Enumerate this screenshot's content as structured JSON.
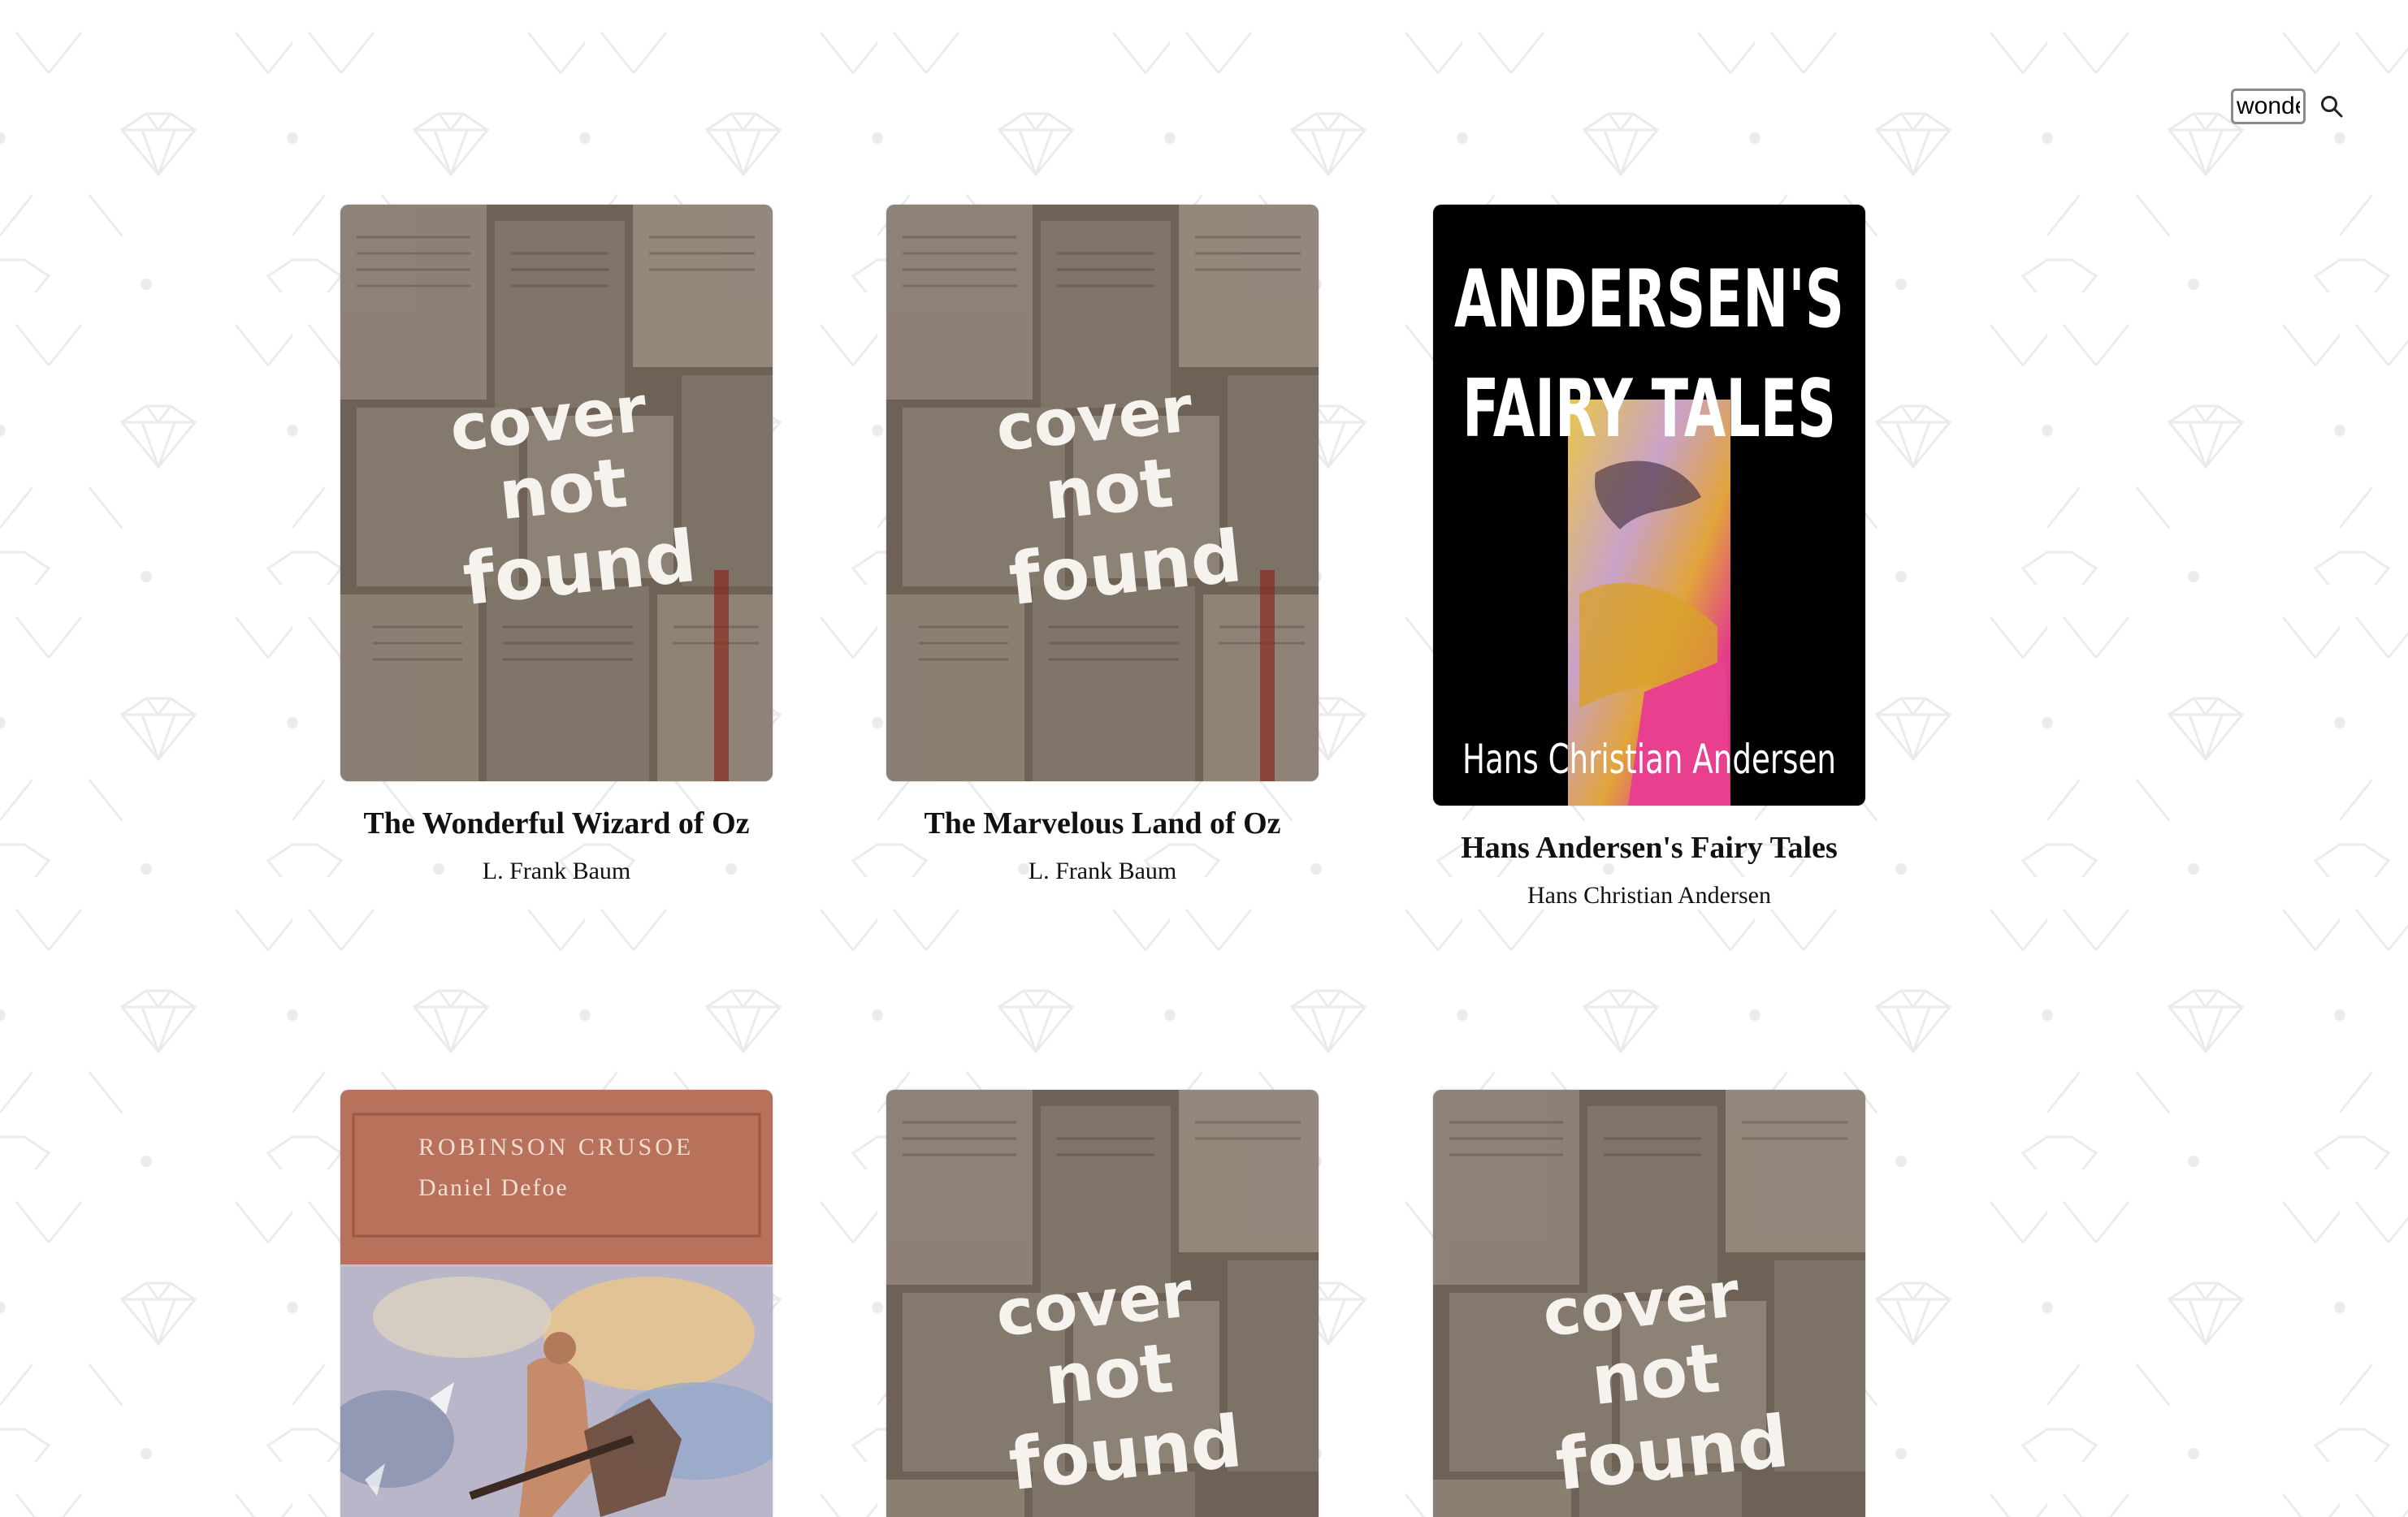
{
  "search": {
    "value": "wonde",
    "icon": "search-icon"
  },
  "books": [
    {
      "title": "The Wonderful Wizard of Oz",
      "author": "L. Frank Baum",
      "cover": {
        "type": "not-found",
        "text_lines": [
          "cover",
          "not",
          "found"
        ]
      }
    },
    {
      "title": "The Marvelous Land of Oz",
      "author": "L. Frank Baum",
      "cover": {
        "type": "not-found",
        "text_lines": [
          "cover",
          "not",
          "found"
        ]
      }
    },
    {
      "title": "Hans Andersen's Fairy Tales",
      "author": "Hans Christian Andersen",
      "cover": {
        "type": "andersen",
        "text_lines": [
          "ANDERSEN'S",
          "FAIRY TALES",
          "Hans Christian Andersen"
        ]
      }
    },
    {
      "title": "",
      "author": "",
      "cover": {
        "type": "crusoe",
        "text_lines": [
          "ROBINSON CRUSOE",
          "Daniel Defoe"
        ]
      }
    },
    {
      "title": "",
      "author": "",
      "cover": {
        "type": "not-found",
        "text_lines": [
          "cover",
          "not",
          "found"
        ]
      }
    },
    {
      "title": "",
      "author": "",
      "cover": {
        "type": "not-found",
        "text_lines": [
          "cover",
          "not",
          "found"
        ]
      }
    }
  ],
  "colors": {
    "pattern": "#ececec",
    "cover_not_found_bg": "#6e6257",
    "andersen_bg": "#000000",
    "crusoe_band": "#b8715a"
  }
}
